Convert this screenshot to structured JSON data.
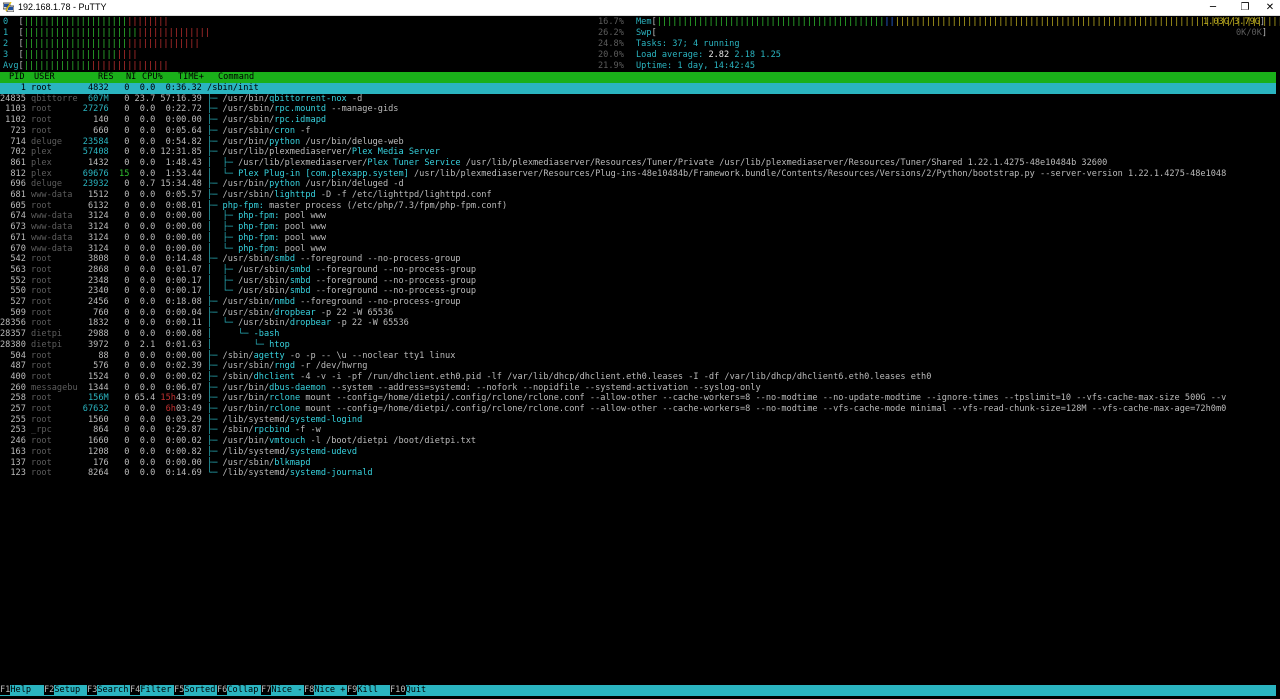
{
  "window": {
    "title": "192.168.1.78 - PuTTY",
    "min": "─",
    "max": "❐",
    "close": "✕"
  },
  "meters": {
    "cpu": [
      {
        "label": "0",
        "pct": "16.7%"
      },
      {
        "label": "1",
        "pct": "26.2%"
      },
      {
        "label": "2",
        "pct": "24.8%"
      },
      {
        "label": "3",
        "pct": "20.0%"
      },
      {
        "label": "Avg",
        "pct": "21.9%"
      }
    ],
    "mem": {
      "label": "Mem",
      "value": "1.03G/3.79G"
    },
    "swp": {
      "label": "Swp",
      "value": "0K/0K"
    },
    "tasks": {
      "label": "Tasks:",
      "value": "37;",
      "running": "4 running"
    },
    "load": {
      "label": "Load average:",
      "v1": "2.82",
      "v2": "2.18",
      "v3": "1.25"
    },
    "uptime": {
      "label": "Uptime:",
      "value": "1 day, 14:42:45"
    }
  },
  "columns": {
    "pid": "PID",
    "user": "USER",
    "res": "RES",
    "ni": "NI",
    "cpu": "CPU%",
    "time": "TIME+",
    "cmd": "Command"
  },
  "processes": [
    {
      "pid": "1",
      "user": "root",
      "res": "4832",
      "ni": "0",
      "cpu": "0.0",
      "time": "0:36.32",
      "tree": "",
      "cmd": "/sbin/init",
      "args": ""
    },
    {
      "pid": "24835",
      "user": "qbittorre",
      "res": "607M",
      "ni": "0",
      "cpu": "23.7",
      "time": "57:16.39",
      "tree": "├─ ",
      "cmd": "/usr/bin/qbittorrent-nox",
      "args": " -d"
    },
    {
      "pid": "1103",
      "user": "root",
      "res": "27276",
      "ni": "0",
      "cpu": "0.0",
      "time": "0:22.72",
      "tree": "├─ ",
      "cmd": "/usr/sbin/rpc.mountd",
      "args": " --manage-gids"
    },
    {
      "pid": "1102",
      "user": "root",
      "res": "140",
      "ni": "0",
      "cpu": "0.0",
      "time": "0:00.00",
      "tree": "├─ ",
      "cmd": "/usr/sbin/rpc.idmapd",
      "args": ""
    },
    {
      "pid": "723",
      "user": "root",
      "res": "660",
      "ni": "0",
      "cpu": "0.0",
      "time": "0:05.64",
      "tree": "├─ ",
      "cmd": "/usr/sbin/cron",
      "args": " -f"
    },
    {
      "pid": "714",
      "user": "deluge",
      "res": "23584",
      "ni": "0",
      "cpu": "0.0",
      "time": "0:54.82",
      "tree": "├─ ",
      "cmd": "/usr/bin/python",
      "args": " /usr/bin/deluge-web"
    },
    {
      "pid": "702",
      "user": "plex",
      "res": "57408",
      "ni": "0",
      "cpu": "0.0",
      "time": "12:31.85",
      "tree": "├─ ",
      "cmd": "/usr/lib/plexmediaserver/Plex Media Server",
      "args": ""
    },
    {
      "pid": "861",
      "user": "plex",
      "res": "1432",
      "ni": "0",
      "cpu": "0.0",
      "time": "1:48.43",
      "tree": "│  ├─ ",
      "cmd": "/usr/lib/plexmediaserver/Plex Tuner Service",
      "args": " /usr/lib/plexmediaserver/Resources/Tuner/Private /usr/lib/plexmediaserver/Resources/Tuner/Shared 1.22.1.4275-48e10484b 32600"
    },
    {
      "pid": "812",
      "user": "plex",
      "res": "69676",
      "ni": "15",
      "cpu": "0.0",
      "time": "1:53.44",
      "tree": "│  └─ ",
      "cmd": "Plex Plug-in [com.plexapp.system]",
      "args": " /usr/lib/plexmediaserver/Resources/Plug-ins-48e10484b/Framework.bundle/Contents/Resources/Versions/2/Python/bootstrap.py --server-version 1.22.1.4275-48e1048"
    },
    {
      "pid": "696",
      "user": "deluge",
      "res": "23932",
      "ni": "0",
      "cpu": "0.7",
      "time": "15:34.48",
      "tree": "├─ ",
      "cmd": "/usr/bin/python",
      "args": " /usr/bin/deluged -d"
    },
    {
      "pid": "681",
      "user": "www-data",
      "res": "1512",
      "ni": "0",
      "cpu": "0.0",
      "time": "0:05.57",
      "tree": "├─ ",
      "cmd": "/usr/sbin/lighttpd",
      "args": " -D -f /etc/lighttpd/lighttpd.conf"
    },
    {
      "pid": "605",
      "user": "root",
      "res": "6132",
      "ni": "0",
      "cpu": "0.0",
      "time": "0:08.01",
      "tree": "├─ ",
      "cmd": "php-fpm:",
      "args": " master process (/etc/php/7.3/fpm/php-fpm.conf)"
    },
    {
      "pid": "674",
      "user": "www-data",
      "res": "3124",
      "ni": "0",
      "cpu": "0.0",
      "time": "0:00.00",
      "tree": "│  ├─ ",
      "cmd": "php-fpm:",
      "args": " pool www"
    },
    {
      "pid": "673",
      "user": "www-data",
      "res": "3124",
      "ni": "0",
      "cpu": "0.0",
      "time": "0:00.00",
      "tree": "│  ├─ ",
      "cmd": "php-fpm:",
      "args": " pool www"
    },
    {
      "pid": "671",
      "user": "www-data",
      "res": "3124",
      "ni": "0",
      "cpu": "0.0",
      "time": "0:00.00",
      "tree": "│  ├─ ",
      "cmd": "php-fpm:",
      "args": " pool www"
    },
    {
      "pid": "670",
      "user": "www-data",
      "res": "3124",
      "ni": "0",
      "cpu": "0.0",
      "time": "0:00.00",
      "tree": "│  └─ ",
      "cmd": "php-fpm:",
      "args": " pool www"
    },
    {
      "pid": "542",
      "user": "root",
      "res": "3808",
      "ni": "0",
      "cpu": "0.0",
      "time": "0:14.48",
      "tree": "├─ ",
      "cmd": "/usr/sbin/smbd",
      "args": " --foreground --no-process-group"
    },
    {
      "pid": "563",
      "user": "root",
      "res": "2868",
      "ni": "0",
      "cpu": "0.0",
      "time": "0:01.07",
      "tree": "│  ├─ ",
      "cmd": "/usr/sbin/smbd",
      "args": " --foreground --no-process-group"
    },
    {
      "pid": "552",
      "user": "root",
      "res": "2348",
      "ni": "0",
      "cpu": "0.0",
      "time": "0:00.17",
      "tree": "│  ├─ ",
      "cmd": "/usr/sbin/smbd",
      "args": " --foreground --no-process-group"
    },
    {
      "pid": "550",
      "user": "root",
      "res": "2340",
      "ni": "0",
      "cpu": "0.0",
      "time": "0:00.17",
      "tree": "│  └─ ",
      "cmd": "/usr/sbin/smbd",
      "args": " --foreground --no-process-group"
    },
    {
      "pid": "527",
      "user": "root",
      "res": "2456",
      "ni": "0",
      "cpu": "0.0",
      "time": "0:18.08",
      "tree": "├─ ",
      "cmd": "/usr/sbin/nmbd",
      "args": " --foreground --no-process-group"
    },
    {
      "pid": "509",
      "user": "root",
      "res": "760",
      "ni": "0",
      "cpu": "0.0",
      "time": "0:00.04",
      "tree": "├─ ",
      "cmd": "/usr/sbin/dropbear",
      "args": " -p 22 -W 65536"
    },
    {
      "pid": "28356",
      "user": "root",
      "res": "1832",
      "ni": "0",
      "cpu": "0.0",
      "time": "0:00.11",
      "tree": "│  └─ ",
      "cmd": "/usr/sbin/dropbear",
      "args": " -p 22 -W 65536"
    },
    {
      "pid": "28357",
      "user": "dietpi",
      "res": "2988",
      "ni": "0",
      "cpu": "0.0",
      "time": "0:00.08",
      "tree": "│     └─ ",
      "cmd": "-bash",
      "args": ""
    },
    {
      "pid": "28380",
      "user": "dietpi",
      "res": "3972",
      "ni": "0",
      "cpu": "2.1",
      "time": "0:01.63",
      "tree": "│        └─ ",
      "cmd": "htop",
      "args": ""
    },
    {
      "pid": "504",
      "user": "root",
      "res": "88",
      "ni": "0",
      "cpu": "0.0",
      "time": "0:00.00",
      "tree": "├─ ",
      "cmd": "/sbin/agetty",
      "args": " -o -p -- \\u --noclear tty1 linux"
    },
    {
      "pid": "487",
      "user": "root",
      "res": "576",
      "ni": "0",
      "cpu": "0.0",
      "time": "0:02.39",
      "tree": "├─ ",
      "cmd": "/usr/sbin/rngd",
      "args": " -r /dev/hwrng"
    },
    {
      "pid": "400",
      "user": "root",
      "res": "1524",
      "ni": "0",
      "cpu": "0.0",
      "time": "0:00.02",
      "tree": "├─ ",
      "cmd": "/sbin/dhclient",
      "args": " -4 -v -i -pf /run/dhclient.eth0.pid -lf /var/lib/dhcp/dhclient.eth0.leases -I -df /var/lib/dhcp/dhclient6.eth0.leases eth0"
    },
    {
      "pid": "260",
      "user": "messagebu",
      "res": "1344",
      "ni": "0",
      "cpu": "0.0",
      "time": "0:06.07",
      "tree": "├─ ",
      "cmd": "/usr/bin/dbus-daemon",
      "args": " --system --address=systemd: --nofork --nopidfile --systemd-activation --syslog-only"
    },
    {
      "pid": "258",
      "user": "root",
      "res": "156M",
      "ni": "0",
      "cpu": "65.4",
      "time": "15h43:09",
      "tree": "├─ ",
      "cmd": "/usr/bin/rclone",
      "args": " mount --config=/home/dietpi/.config/rclone/rclone.conf --allow-other --cache-workers=8 --no-modtime --no-update-modtime --ignore-times --tpslimit=10 --vfs-cache-max-size 500G --v"
    },
    {
      "pid": "257",
      "user": "root",
      "res": "67632",
      "ni": "0",
      "cpu": "0.0",
      "time": "6h03:49",
      "tree": "├─ ",
      "cmd": "/usr/bin/rclone",
      "args": " mount --config=/home/dietpi/.config/rclone/rclone.conf --allow-other --cache-workers=8 --no-modtime --vfs-cache-mode minimal --vfs-read-chunk-size=128M --vfs-cache-max-age=72h0m0"
    },
    {
      "pid": "255",
      "user": "root",
      "res": "1560",
      "ni": "0",
      "cpu": "0.0",
      "time": "0:03.29",
      "tree": "├─ ",
      "cmd": "/lib/systemd/systemd-logind",
      "args": ""
    },
    {
      "pid": "253",
      "user": "_rpc",
      "res": "864",
      "ni": "0",
      "cpu": "0.0",
      "time": "0:29.87",
      "tree": "├─ ",
      "cmd": "/sbin/rpcbind",
      "args": " -f -w"
    },
    {
      "pid": "246",
      "user": "root",
      "res": "1660",
      "ni": "0",
      "cpu": "0.0",
      "time": "0:00.02",
      "tree": "├─ ",
      "cmd": "/usr/bin/vmtouch",
      "args": " -l /boot/dietpi /boot/dietpi.txt"
    },
    {
      "pid": "163",
      "user": "root",
      "res": "1208",
      "ni": "0",
      "cpu": "0.0",
      "time": "0:00.82",
      "tree": "├─ ",
      "cmd": "/lib/systemd/systemd-udevd",
      "args": ""
    },
    {
      "pid": "137",
      "user": "root",
      "res": "176",
      "ni": "0",
      "cpu": "0.0",
      "time": "0:00.00",
      "tree": "├─ ",
      "cmd": "/usr/sbin/blkmapd",
      "args": ""
    },
    {
      "pid": "123",
      "user": "root",
      "res": "8264",
      "ni": "0",
      "cpu": "0.0",
      "time": "0:14.69",
      "tree": "└─ ",
      "cmd": "/lib/systemd/systemd-journald",
      "args": ""
    }
  ],
  "fkeys": [
    {
      "key": "F1",
      "label": "Help  "
    },
    {
      "key": "F2",
      "label": "Setup "
    },
    {
      "key": "F3",
      "label": "Search"
    },
    {
      "key": "F4",
      "label": "Filter"
    },
    {
      "key": "F5",
      "label": "Sorted"
    },
    {
      "key": "F6",
      "label": "Collap"
    },
    {
      "key": "F7",
      "label": "Nice -"
    },
    {
      "key": "F8",
      "label": "Nice +"
    },
    {
      "key": "F9",
      "label": "Kill  "
    },
    {
      "key": "F10",
      "label": "Quit"
    }
  ],
  "colors": {
    "cyan": "#2ab4c0",
    "header_green": "#1ab01a",
    "bar_green": "#30c030",
    "bar_red": "#c03030",
    "bar_yellow": "#c0b020"
  }
}
